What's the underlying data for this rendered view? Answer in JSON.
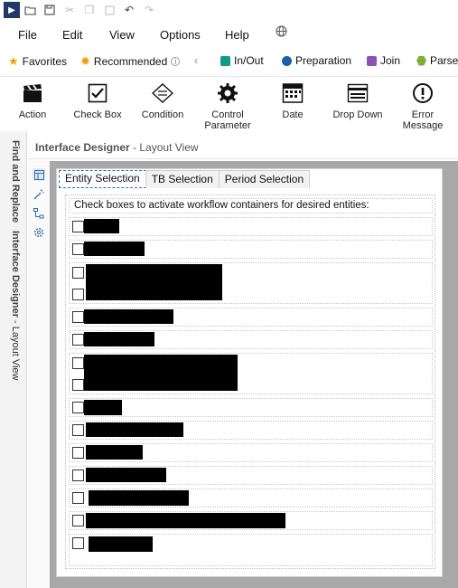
{
  "menu": {
    "file": "File",
    "edit": "Edit",
    "view": "View",
    "options": "Options",
    "help": "Help"
  },
  "favorites": {
    "favorites": "Favorites",
    "recommended": "Recommended",
    "in_out": "In/Out",
    "preparation": "Preparation",
    "join": "Join",
    "parse": "Parse",
    "colors": {
      "in_out": "#0f9a8a",
      "preparation": "#1f5fa8",
      "join": "#8a52b8",
      "parse": "#7fae3a"
    }
  },
  "tools": [
    {
      "label": "Action",
      "icon": "clapperboard-icon"
    },
    {
      "label": "Check Box",
      "icon": "checkbox-icon"
    },
    {
      "label": "Condition",
      "icon": "condition-icon"
    },
    {
      "label": "Control Parameter",
      "icon": "gear-icon"
    },
    {
      "label": "Date",
      "icon": "calendar-icon"
    },
    {
      "label": "Drop Down",
      "icon": "dropdown-icon"
    },
    {
      "label": "Error Message",
      "icon": "error-icon"
    }
  ],
  "left_panel": {
    "find_replace": "Find and Replace",
    "designer": "Interface Designer",
    "designer_suffix": " - Layout View"
  },
  "designer": {
    "title": "Interface Designer",
    "suffix": " - Layout View"
  },
  "tabs": [
    "Entity Selection",
    "TB Selection",
    "Period Selection"
  ],
  "instruction": "Check boxes to activate workflow containers for desired entities:"
}
